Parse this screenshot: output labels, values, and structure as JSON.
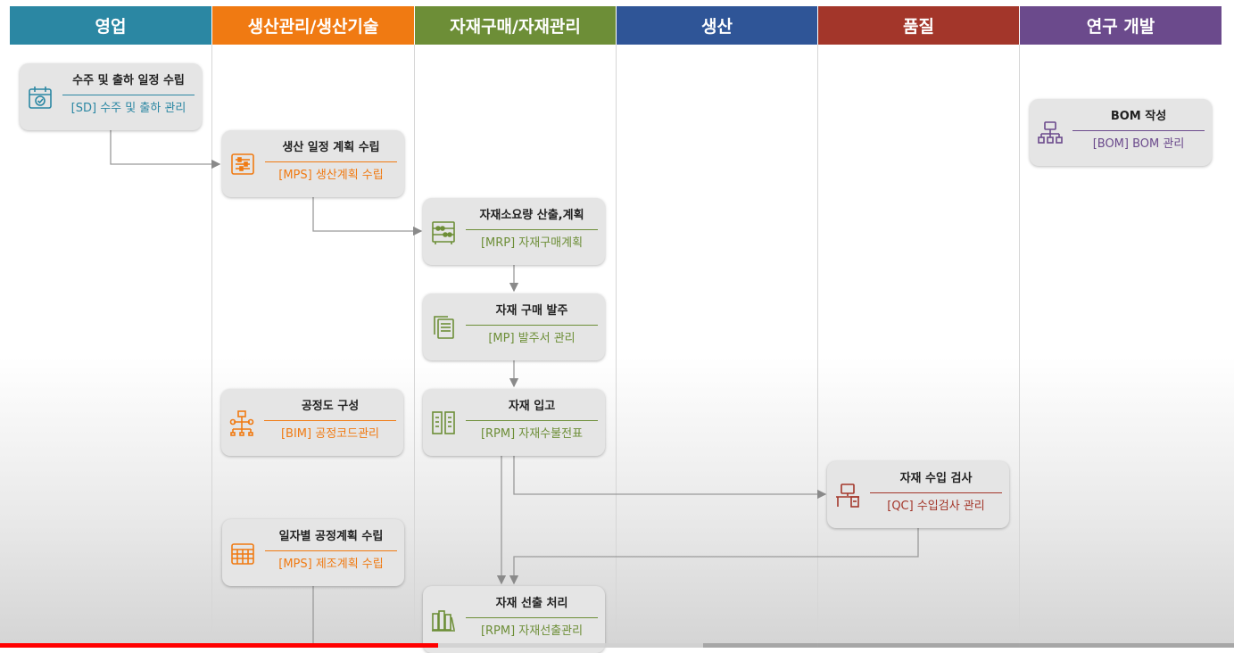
{
  "colors": {
    "sales": "#2b87a3",
    "production_mgmt": "#f07a12",
    "materials": "#6d8e37",
    "production": "#2f5597",
    "quality": "#a3362a",
    "rnd": "#6b4a8c"
  },
  "headers": [
    "영업",
    "생산관리/생산기술",
    "자재구매/자재관리",
    "생산",
    "품질",
    "연구 개발"
  ],
  "cards": {
    "sd": {
      "title": "수주 및 출하 일정 수립",
      "sub": "[SD] 수주 및 출하 관리",
      "icon": "calendar-check-icon"
    },
    "bom": {
      "title": "BOM 작성",
      "sub": "[BOM] BOM 관리",
      "icon": "hierarchy-icon"
    },
    "mps": {
      "title": "생산 일정 계획 수립",
      "sub": "[MPS] 생산계획 수립",
      "icon": "sliders-icon"
    },
    "mrp": {
      "title": "자재소요량 산출,계획",
      "sub": "[MRP] 자재구매계획",
      "icon": "abacus-icon"
    },
    "mp": {
      "title": "자재 구매 발주",
      "sub": "[MP] 발주서 관리",
      "icon": "document-stack-icon"
    },
    "bim": {
      "title": "공정도 구성",
      "sub": "[BIM] 공정코드관리",
      "icon": "process-tree-icon"
    },
    "rpm_in": {
      "title": "자재 입고",
      "sub": "[RPM] 자재수불전표",
      "icon": "storage-shelves-icon"
    },
    "qc": {
      "title": "자재 수입 검사",
      "sub": "[QC] 수입검사 관리",
      "icon": "inspection-desk-icon"
    },
    "mps2": {
      "title": "일자별 공정계획 수립",
      "sub": "[MPS] 제조계획 수립",
      "icon": "calendar-grid-icon"
    },
    "rpm_out": {
      "title": "자재 선출 처리",
      "sub": "[RPM] 자재선출관리",
      "icon": "books-icon"
    }
  },
  "video_progress": {
    "played": 0.355,
    "buffered": 0.57
  }
}
